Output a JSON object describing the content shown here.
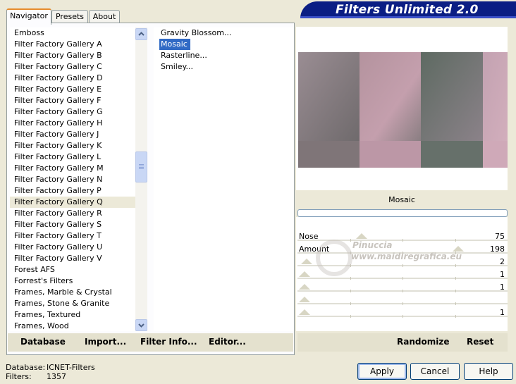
{
  "banner": {
    "title": "Filters Unlimited 2.0"
  },
  "tabs": [
    {
      "label": "Navigator",
      "active": true
    },
    {
      "label": "Presets",
      "active": false
    },
    {
      "label": "About",
      "active": false
    }
  ],
  "categories": {
    "items": [
      "Emboss",
      "Filter Factory Gallery A",
      "Filter Factory Gallery B",
      "Filter Factory Gallery C",
      "Filter Factory Gallery D",
      "Filter Factory Gallery E",
      "Filter Factory Gallery F",
      "Filter Factory Gallery G",
      "Filter Factory Gallery H",
      "Filter Factory Gallery J",
      "Filter Factory Gallery K",
      "Filter Factory Gallery L",
      "Filter Factory Gallery M",
      "Filter Factory Gallery N",
      "Filter Factory Gallery P",
      "Filter Factory Gallery Q",
      "Filter Factory Gallery R",
      "Filter Factory Gallery S",
      "Filter Factory Gallery T",
      "Filter Factory Gallery U",
      "Filter Factory Gallery V",
      "Forest AFS",
      "Forrest's Filters",
      "Frames, Marble & Crystal",
      "Frames, Stone & Granite",
      "Frames, Textured",
      "Frames, Wood"
    ],
    "selected": "Filter Factory Gallery Q"
  },
  "filters": {
    "items": [
      "Gravity Blossom...",
      "Mosaic",
      "Rasterline...",
      "Smiley..."
    ],
    "selected": "Mosaic"
  },
  "left_actions": {
    "database": "Database",
    "import": "Import...",
    "filter_info": "Filter Info...",
    "editor": "Editor..."
  },
  "right_actions": {
    "randomize": "Randomize",
    "reset": "Reset"
  },
  "preview": {
    "filter_name": "Mosaic"
  },
  "sliders": [
    {
      "label": "Nose",
      "value": "75",
      "level": 0.29
    },
    {
      "label": "Amount",
      "value": "198",
      "level": 0.78
    },
    {
      "label": "",
      "value": "2",
      "level": 0.01
    },
    {
      "label": "",
      "value": "1",
      "level": 0.0
    },
    {
      "label": "",
      "value": "1",
      "level": 0.0
    },
    {
      "label": "",
      "value": "",
      "level": 0.0
    },
    {
      "label": "",
      "value": "1",
      "level": 0.0
    }
  ],
  "watermark": {
    "line1": "Pinuccia",
    "line2": "www.maidiregrafica.eu"
  },
  "status": {
    "database_label": "Database:",
    "database_value": "ICNET-Filters",
    "filters_label": "Filters:",
    "filters_value": "1357"
  },
  "buttons": {
    "apply": "Apply",
    "cancel": "Cancel",
    "help": "Help"
  },
  "colors": {
    "banner": "#0B1E84",
    "selection": "#316AC5",
    "dialog_bg": "#ECE9D8"
  }
}
